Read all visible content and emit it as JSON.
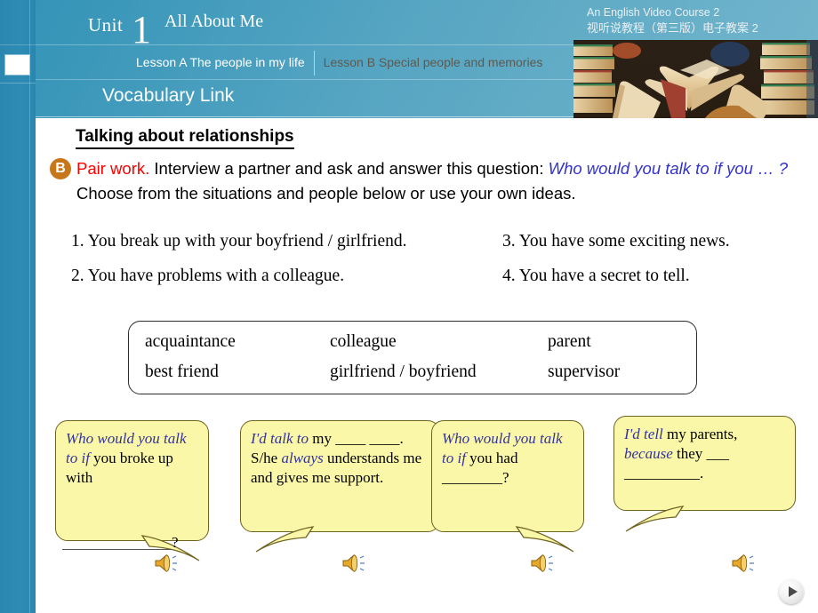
{
  "header": {
    "unit_word": "Unit",
    "unit_number": "1",
    "unit_title": "All About Me",
    "course_en": "An English Video Course 2",
    "course_zh": "视听说教程（第三版）电子教案 2",
    "tabs": [
      {
        "label": "Lesson A The people in my life",
        "active": true
      },
      {
        "label": "Lesson B Special people and memories",
        "active": false
      }
    ],
    "section_label": "Vocabulary Link",
    "photo_alt": "stack-of-open-books-photo"
  },
  "main": {
    "section_title": "Talking about relationships",
    "exercise_letter": "B",
    "instruction": {
      "lead_red": "Pair work.",
      "text1": " Interview a partner and ask and answer this question: ",
      "question_italic": "Who would you talk to if you … ?",
      "text2": " Choose from the situations and people below or use your own ideas."
    },
    "situations": [
      {
        "num": "1.",
        "text": "You break up with your boyfriend / girlfriend."
      },
      {
        "num": "3.",
        "text": "You have some exciting news."
      },
      {
        "num": "2.",
        "text": "You have problems with a colleague."
      },
      {
        "num": "4.",
        "text": "You have a secret to tell."
      }
    ],
    "word_box": [
      [
        "acquaintance",
        "colleague",
        "parent"
      ],
      [
        "best friend",
        "girlfriend / boyfriend",
        "supervisor"
      ]
    ],
    "bubbles": [
      {
        "id": "bubble-1",
        "blue_text": "Who would you talk to if",
        "black_text": " you broke up with",
        "overflow_mark": "?",
        "tail": "down-right",
        "speaker_icon": "speaker-icon"
      },
      {
        "id": "bubble-2",
        "blue_text": "I'd talk to",
        "black_text": " my ____ ____. S/he ",
        "blue_text2": "always",
        "black_text2": " understands me and gives me support.",
        "tail": "down-left",
        "speaker_icon": "speaker-icon"
      },
      {
        "id": "bubble-3",
        "blue_text": "Who would you talk to if",
        "black_text": " you had ________?",
        "tail": "down-right",
        "speaker_icon": "speaker-icon"
      },
      {
        "id": "bubble-4",
        "blue_text": "I'd tell",
        "black_text": " my parents, ",
        "blue_text2": "because",
        "black_text2": " they ___ __________.",
        "tail": "down-left",
        "speaker_icon": "speaker-icon"
      }
    ]
  },
  "controls": {
    "play_label": "play-next",
    "play_glyph": "▶"
  },
  "colors": {
    "header_blue": "#3494b8",
    "rail_blue": "#2e8cb4",
    "badge_orange": "#c8761a",
    "accent_red": "#ff0000",
    "accent_blue": "#333399",
    "bubble_yellow": "#faf7a8",
    "bubble_border": "#6e6321"
  }
}
